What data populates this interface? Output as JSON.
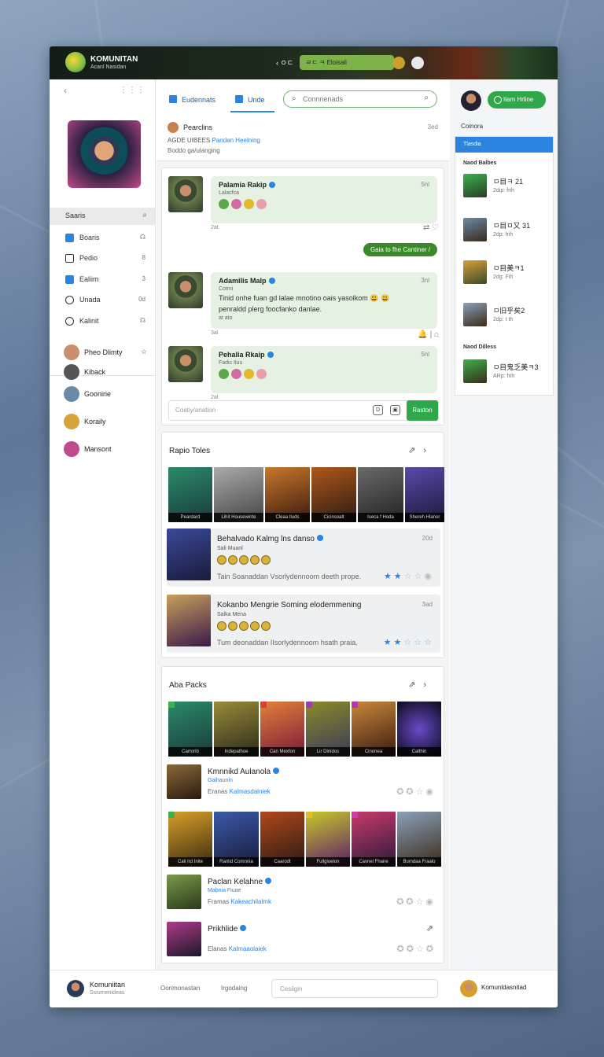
{
  "app": {
    "name": "KOMUNITAN",
    "subtitle": "Acanl Nasidan"
  },
  "topbar": {
    "back_label": "‹ ㅇㄷ",
    "search_text": "ㄹㄷ ㅋ Eloisali"
  },
  "sidebar": {
    "search_label": "Saaris",
    "nav": [
      {
        "label": "Boaris",
        "right": "☊",
        "icon_color": "#2a84e0"
      },
      {
        "label": "Pedio",
        "right": "8",
        "icon_color": "#ffffff"
      },
      {
        "label": "Ealiim",
        "right": "3",
        "icon_color": "#2a84e0"
      },
      {
        "label": "Unada",
        "right": "0d",
        "icon_color": "#ffffff"
      },
      {
        "label": "Kalinit",
        "right": "☊",
        "icon_color": "#ffffff"
      }
    ],
    "users": [
      {
        "name": "Pheo Dlimty",
        "status": "☆",
        "color": "#c98e6a"
      },
      {
        "name": "Kiback",
        "status": "",
        "color": "#555555"
      },
      {
        "name": "Goonirie",
        "status": "",
        "color": "#6a8aa8"
      },
      {
        "name": "Koraily",
        "status": "",
        "color": "#d8a23a"
      },
      {
        "name": "Mansont",
        "status": "",
        "color": "#c04a8a"
      }
    ]
  },
  "tabs": [
    {
      "label": "Eudennats",
      "active": false
    },
    {
      "label": "Unde",
      "active": true
    }
  ],
  "main_search": {
    "placeholder": "Connnenads"
  },
  "post": {
    "author": "Pearclins",
    "time": "3ed",
    "line1": "AGDE UIBEES",
    "line1_link": "Pandan Heelning",
    "line2": "Boddo ga/ulanging"
  },
  "chat": {
    "messages": [
      {
        "name": "Palamia Rakip",
        "time": "5nl",
        "sub": "Lalacfca",
        "text": "",
        "meta": "2at"
      },
      {
        "name": "Adamilis Malp",
        "time": "3nl",
        "sub": "Cotmi",
        "text": "Tinid onhe fuan gd lalae mnotino oais yasolkom 😃 😃",
        "text2": "penraldd plerg foocfanko danlae.",
        "sub2": "at ato",
        "meta": "3al"
      },
      {
        "name": "Pehalia Rkaip",
        "time": "5nl",
        "sub": "Fadic Iluu",
        "text": "",
        "meta": "2al"
      }
    ],
    "pill": "Gaia to fhe Cantiner /",
    "composer_placeholder": "Coatiy/anation",
    "send": "Raston"
  },
  "card1": {
    "title": "Rapio Toles",
    "thumbs": [
      "Peardard",
      "Lihit Housewinte",
      "Cleaa Iluds",
      "Cicinsoalt",
      "Iseca f Hoda",
      "Shereh Hlanor"
    ],
    "rows": [
      {
        "title": "Behalvado Kalmg lns danso",
        "sub": "Sali Muanl",
        "desc": "Tain Soanaddan Vsorlydennoom deeth prope.",
        "time": "20d"
      },
      {
        "title": "Kokanbo Mengrie Soming elodemmening",
        "sub": "Salka Mena",
        "desc": "Tum deonaddan IIsorlydennoom hsath praia.",
        "time": "3ad"
      }
    ]
  },
  "card2": {
    "title": "Aba Packs",
    "thumbs_a": [
      "Carrorib",
      "Indepathoe",
      "Can Mexfon",
      "Lir Dinidos",
      "Cinonea",
      "Calthin"
    ],
    "thumbs_b": [
      "Cali Ird Inite",
      "Ranlid Comnnia",
      "Caarodt",
      "Fullgioelon",
      "Cavnel Fhaire",
      "Bumdaa Fraalo"
    ],
    "items": [
      {
        "title": "Kmnnikd Aulanola",
        "sub": "Gaihaunin",
        "desc": "Eranas",
        "desc_link": "Kalmasdalniek"
      },
      {
        "title": "Paclan Kelahne",
        "sub": "Mabnia Fiuae",
        "desc": "Framas",
        "desc_link": "Kakeachilalmk"
      },
      {
        "title": "Prikhlide",
        "sub": "",
        "desc": "Elanas",
        "desc_link": "Kalmaaolaiek"
      }
    ]
  },
  "right": {
    "button": "Ilam Hrline",
    "label": "Coinora",
    "panel_head": "Tlasdia",
    "section1": "Naod Balbes",
    "items": [
      {
        "title": "ㅁ目ㅋ 21",
        "sub": "2dip: frih"
      },
      {
        "title": "ㅁ目ㅁ又 31",
        "sub": "2dp: frih"
      },
      {
        "title": "ㅁ目美ㅋ1",
        "sub": "2dg: Fih"
      },
      {
        "title": "ㅁ旧乎矣2",
        "sub": "2dp: t th"
      }
    ],
    "section2": "Naod Dilless",
    "item_last": {
      "title": "ㅁ目鬼乏美ㅋ3",
      "sub": "ARp: frih"
    }
  },
  "footer": {
    "name": "Komuniitan",
    "sub": "Ssiurnenideas",
    "link1": "Oonmonastan",
    "link2": "Irgodaing",
    "input_placeholder": "Cesilgin",
    "right_name": "Komunldasnitad"
  }
}
